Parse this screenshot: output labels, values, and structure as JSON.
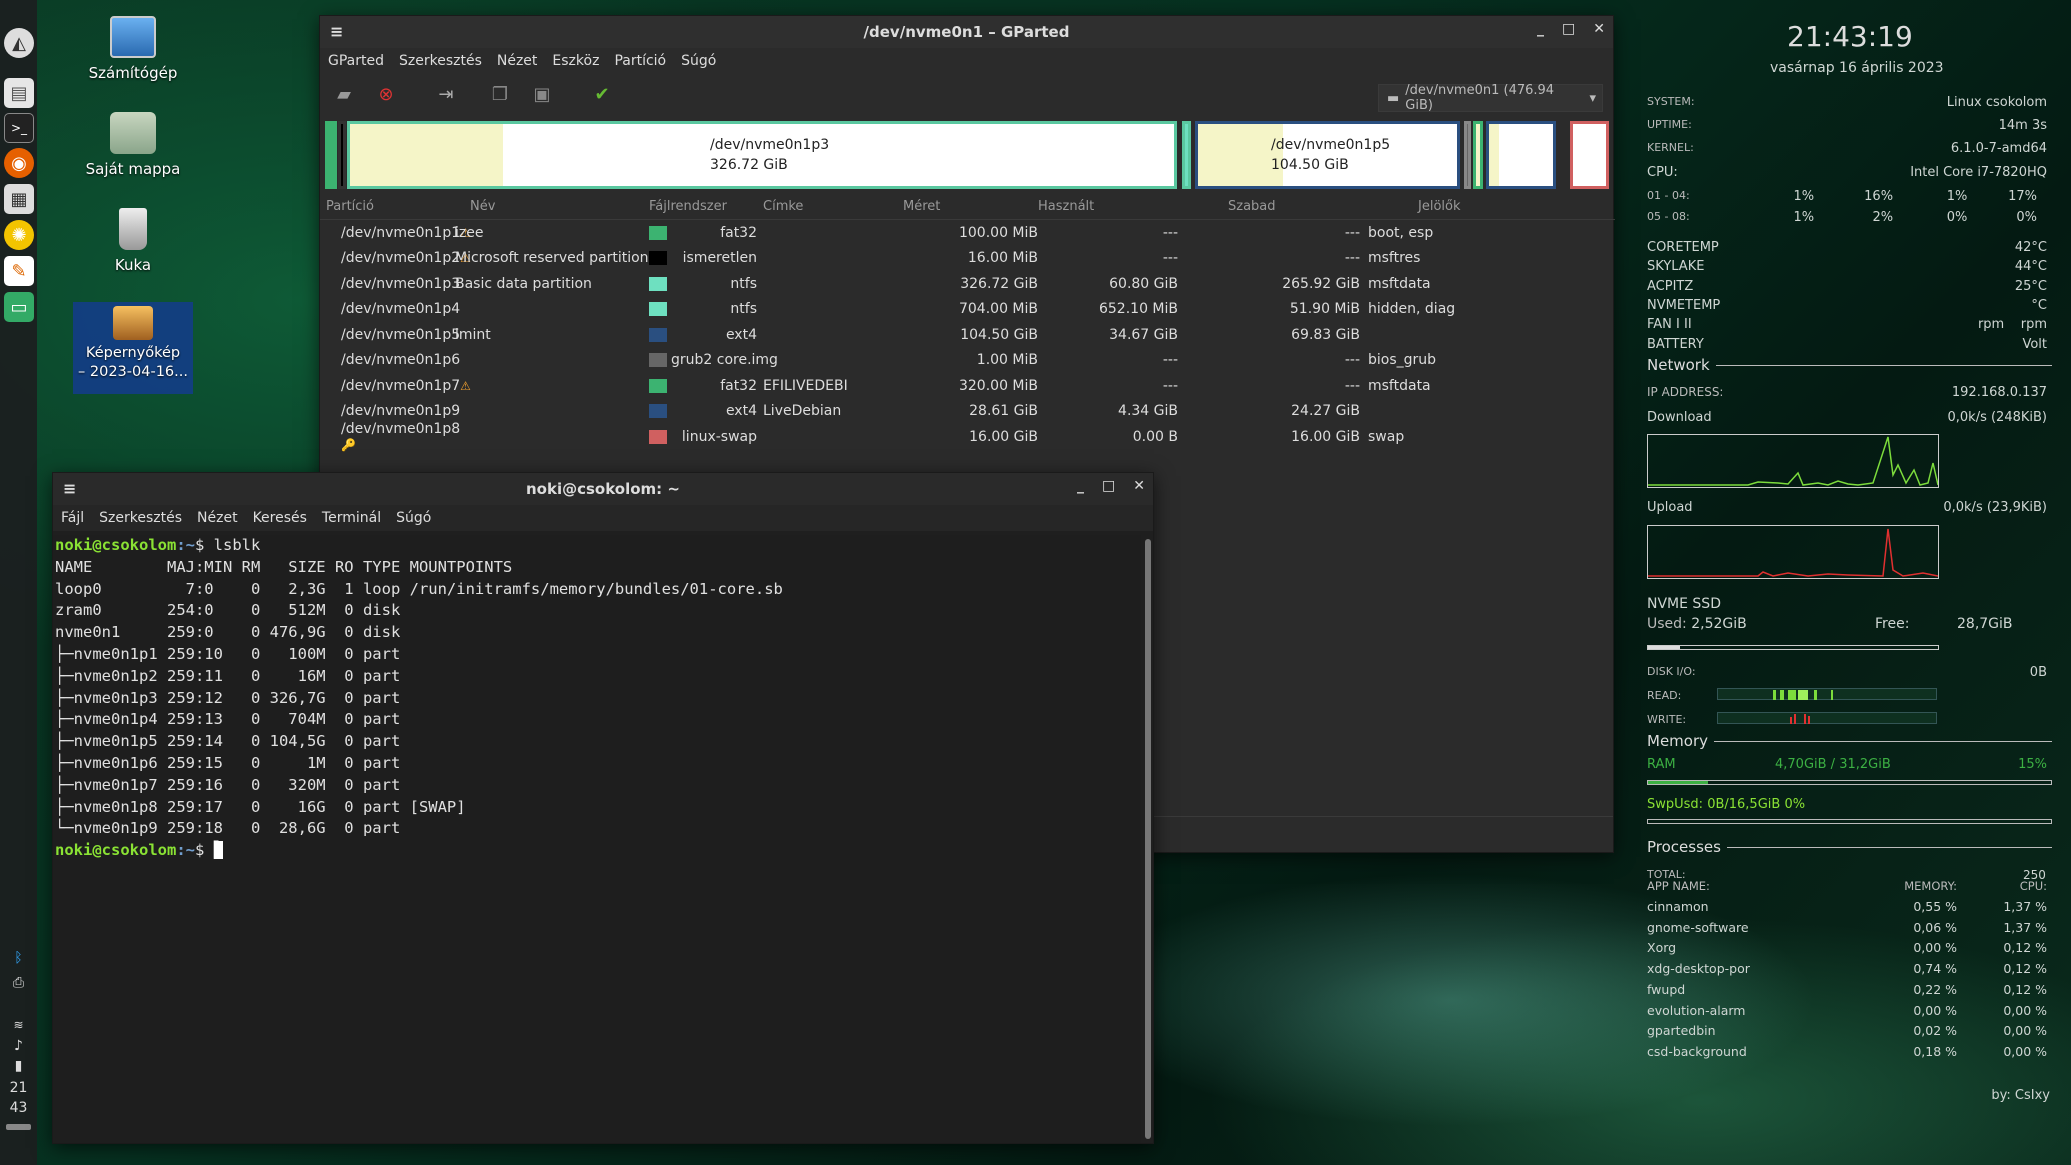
{
  "desktop_icons": [
    {
      "label": "Számítógép"
    },
    {
      "label": "Saját mappa"
    },
    {
      "label": "Kuka"
    },
    {
      "label": "Képernyőkép\n– 2023-04-16..."
    }
  ],
  "panel": {
    "clock_hour": "21",
    "clock_min": "43"
  },
  "gparted": {
    "title": "/dev/nvme0n1 – GParted",
    "menu": [
      "GParted",
      "Szerkesztés",
      "Nézet",
      "Eszköz",
      "Partíció",
      "Súgó"
    ],
    "device_selector": "/dev/nvme0n1 (476.94 GiB)",
    "map": {
      "p3": {
        "name": "/dev/nvme0n1p3",
        "size": "326.72 GiB",
        "used_frac": 0.186
      },
      "p5": {
        "name": "/dev/nvme0n1p5",
        "size": "104.50 GiB",
        "used_frac": 0.33
      }
    },
    "headers": [
      "Partíció",
      "Név",
      "Fájlrendszer",
      "Címke",
      "Méret",
      "Használt",
      "Szabad",
      "Jelölők"
    ],
    "rows": [
      {
        "part": "/dev/nvme0n1p1",
        "warn": "⚠",
        "name": "izee",
        "color": "#3cb371",
        "fs": "fat32",
        "label": "",
        "size": "100.00 MiB",
        "used": "---",
        "free": "---",
        "flags": "boot, esp"
      },
      {
        "part": "/dev/nvme0n1p2",
        "warn": "⚠",
        "name": "Microsoft reserved partition",
        "color": "#000000",
        "fs": "ismeretlen",
        "label": "",
        "size": "16.00 MiB",
        "used": "---",
        "free": "---",
        "flags": "msftres"
      },
      {
        "part": "/dev/nvme0n1p3",
        "warn": "",
        "name": "Basic data partition",
        "color": "#6ee0c0",
        "fs": "ntfs",
        "label": "",
        "size": "326.72 GiB",
        "used": "60.80 GiB",
        "free": "265.92 GiB",
        "flags": "msftdata"
      },
      {
        "part": "/dev/nvme0n1p4",
        "warn": "",
        "name": "",
        "color": "#6ee0c0",
        "fs": "ntfs",
        "label": "",
        "size": "704.00 MiB",
        "used": "652.10 MiB",
        "free": "51.90 MiB",
        "flags": "hidden, diag"
      },
      {
        "part": "/dev/nvme0n1p5",
        "warn": "",
        "name": "lmint",
        "color": "#2a4f80",
        "fs": "ext4",
        "label": "",
        "size": "104.50 GiB",
        "used": "34.67 GiB",
        "free": "69.83 GiB",
        "flags": ""
      },
      {
        "part": "/dev/nvme0n1p6",
        "warn": "",
        "name": "",
        "color": "#666666",
        "fs": "grub2 core.img",
        "label": "",
        "size": "1.00 MiB",
        "used": "---",
        "free": "---",
        "flags": "bios_grub"
      },
      {
        "part": "/dev/nvme0n1p7",
        "warn": "⚠",
        "name": "",
        "color": "#3cb371",
        "fs": "fat32",
        "label": "EFILIVEDEBI",
        "size": "320.00 MiB",
        "used": "---",
        "free": "---",
        "flags": "msftdata"
      },
      {
        "part": "/dev/nvme0n1p9",
        "warn": "",
        "name": "",
        "color": "#2a4f80",
        "fs": "ext4",
        "label": "LiveDebian",
        "size": "28.61 GiB",
        "used": "4.34 GiB",
        "free": "24.27 GiB",
        "flags": ""
      },
      {
        "part": "/dev/nvme0n1p8",
        "warn": "🔑",
        "name": "",
        "color": "#d06060",
        "fs": "linux-swap",
        "label": "",
        "size": "16.00 GiB",
        "used": "0.00 B",
        "free": "16.00 GiB",
        "flags": "swap"
      }
    ]
  },
  "terminal": {
    "title": "noki@csokolom: ~",
    "menu": [
      "Fájl",
      "Szerkesztés",
      "Nézet",
      "Keresés",
      "Terminál",
      "Súgó"
    ],
    "prompt_user": "noki@csokolom",
    "prompt_path": ":~",
    "prompt_sign": "$",
    "command": " lsblk",
    "output": [
      "NAME        MAJ:MIN RM   SIZE RO TYPE MOUNTPOINTS",
      "loop0         7:0    0   2,3G  1 loop /run/initramfs/memory/bundles/01-core.sb",
      "zram0       254:0    0   512M  0 disk",
      "nvme0n1     259:0    0 476,9G  0 disk",
      "├─nvme0n1p1 259:10   0   100M  0 part",
      "├─nvme0n1p2 259:11   0    16M  0 part",
      "├─nvme0n1p3 259:12   0 326,7G  0 part",
      "├─nvme0n1p4 259:13   0   704M  0 part",
      "├─nvme0n1p5 259:14   0 104,5G  0 part",
      "├─nvme0n1p6 259:15   0     1M  0 part",
      "├─nvme0n1p7 259:16   0   320M  0 part",
      "├─nvme0n1p8 259:17   0    16G  0 part [SWAP]",
      "└─nvme0n1p9 259:18   0  28,6G  0 part"
    ]
  },
  "conky": {
    "time": "21:43:19",
    "date": "vasárnap 16 április 2023",
    "system_label": "SYSTEM:",
    "system": "Linux csokolom",
    "uptime_label": "UPTIME:",
    "uptime": "14m 3s",
    "kernel_label": "KERNEL:",
    "kernel": "6.1.0-7-amd64",
    "cpu_label": "CPU:",
    "cpu": "Intel Core i7-7820HQ",
    "cores1_label": "01 - 04:",
    "cores1": [
      "1%",
      "16%",
      "1%",
      "17%"
    ],
    "cores2_label": "05 - 08:",
    "cores2": [
      "1%",
      "2%",
      "0%",
      "0%"
    ],
    "temps": [
      {
        "label": "CORETEMP",
        "value": "42°C"
      },
      {
        "label": "SKYLAKE",
        "value": "44°C"
      },
      {
        "label": "ACPITZ",
        "value": "25°C"
      },
      {
        "label": "NVMETEMP",
        "value": "°C"
      }
    ],
    "fan_label": "FAN I II",
    "fan_a": "rpm",
    "fan_b": "rpm",
    "battery_label": "BATTERY",
    "battery": "Volt",
    "network_title": "Network",
    "ip_label": "IP ADDRESS:",
    "ip": "192.168.0.137",
    "download_label": "Download",
    "download": "0,0k/s (248KiB)",
    "upload_label": "Upload",
    "upload": "0,0k/s (23,9KiB)",
    "ssd_title": "NVME SSD",
    "ssd_used_label": "Used:",
    "ssd_used": "2,52GiB",
    "ssd_free_label": "Free:",
    "ssd_free": "28,7GiB",
    "ssd_used_frac": 0.11,
    "diskio_label": "DISK I/O:",
    "diskio": "0B",
    "read_label": "READ:",
    "write_label": "WRITE:",
    "memory_title": "Memory",
    "ram_label": "RAM",
    "ram": "4,70GiB / 31,2GiB",
    "ram_pct": "15%",
    "ram_frac": 0.15,
    "swap": "SwpUsd: 0B/16,5GiB 0%",
    "processes_title": "Processes",
    "total_label": "TOTAL:",
    "total": "250",
    "proc_headers": [
      "APP NAME:",
      "MEMORY:",
      "CPU:"
    ],
    "processes": [
      {
        "name": "cinnamon",
        "mem": "0,55 %",
        "cpu": "1,37 %"
      },
      {
        "name": "gnome-software",
        "mem": "0,06 %",
        "cpu": "1,37 %"
      },
      {
        "name": "Xorg",
        "mem": "0,00 %",
        "cpu": "0,12 %"
      },
      {
        "name": "xdg-desktop-por",
        "mem": "0,74 %",
        "cpu": "0,12 %"
      },
      {
        "name": "fwupd",
        "mem": "0,22 %",
        "cpu": "0,12 %"
      },
      {
        "name": "evolution-alarm",
        "mem": "0,00 %",
        "cpu": "0,00 %"
      },
      {
        "name": "gpartedbin",
        "mem": "0,02 %",
        "cpu": "0,00 %"
      },
      {
        "name": "csd-background",
        "mem": "0,18 %",
        "cpu": "0,00 %"
      }
    ],
    "credit": "by: CsIxy"
  }
}
